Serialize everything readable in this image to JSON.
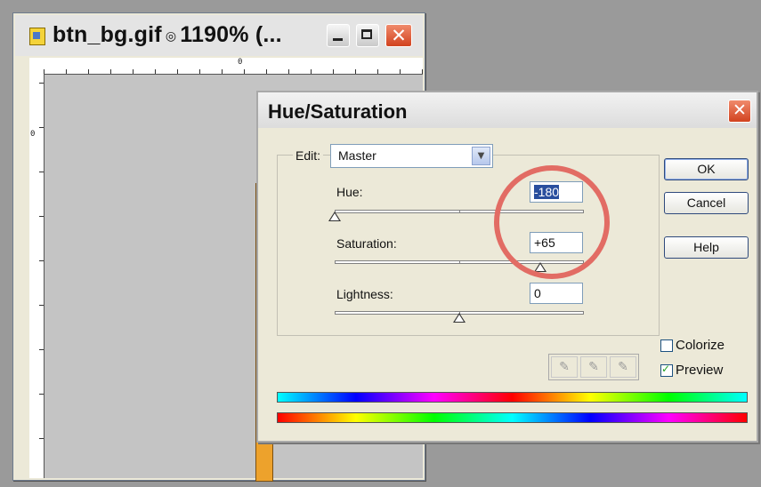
{
  "document": {
    "title": "btn_bg.gif",
    "title_icon": "lock-icon",
    "zoom_text": "1190% (...",
    "ruler_zero": "0",
    "bar_color": "#eda22c",
    "controls": {
      "minimize": "minimize-icon",
      "maximize": "maximize-icon",
      "close": "close-icon"
    }
  },
  "dialog": {
    "title": "Hue/Saturation",
    "edit_label": "Edit:",
    "edit_value": "Master",
    "hue": {
      "label": "Hue:",
      "value": "-180",
      "slider_fraction": 0.0
    },
    "saturation": {
      "label": "Saturation:",
      "value": "+65",
      "slider_fraction": 0.825
    },
    "lightness": {
      "label": "Lightness:",
      "value": "0",
      "slider_fraction": 0.5
    },
    "buttons": {
      "ok": "OK",
      "cancel": "Cancel",
      "help": "Help"
    },
    "colorize": {
      "label": "Colorize",
      "checked": false
    },
    "preview": {
      "label": "Preview",
      "checked": true
    },
    "eyedroppers": [
      "eyedropper-icon",
      "eyedropper-plus-icon",
      "eyedropper-minus-icon"
    ]
  },
  "annotation_color": "#e26c64"
}
